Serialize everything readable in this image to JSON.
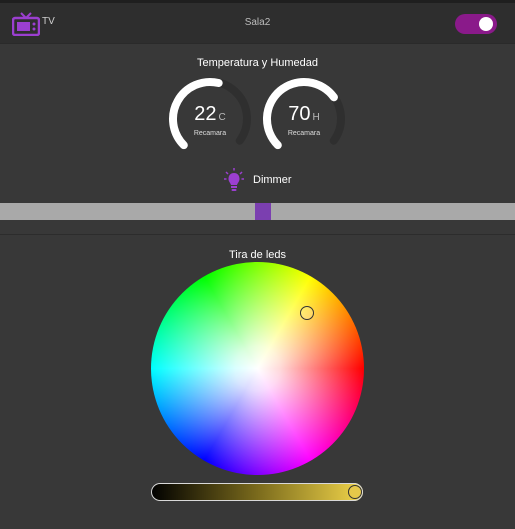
{
  "tv": {
    "label": "TV",
    "room": "Sala2",
    "toggle_on": true
  },
  "climate": {
    "title": "Temperatura y Humedad",
    "temperature": {
      "value": "22",
      "unit": "C",
      "label": "Recamara",
      "level": 0.55
    },
    "humidity": {
      "value": "70",
      "unit": "H",
      "label": "Recamara",
      "level": 0.7
    }
  },
  "dimmer": {
    "label": "Dimmer",
    "level": 0.5
  },
  "leds": {
    "title": "Tira de leds",
    "brightness": 1.0
  },
  "colors": {
    "accent": "#8a1a8a",
    "slider_thumb": "#7b3fb0",
    "icon": "#9b3fd0"
  },
  "icons": {
    "tv": "tv-icon",
    "bulb": "lightbulb-icon"
  }
}
